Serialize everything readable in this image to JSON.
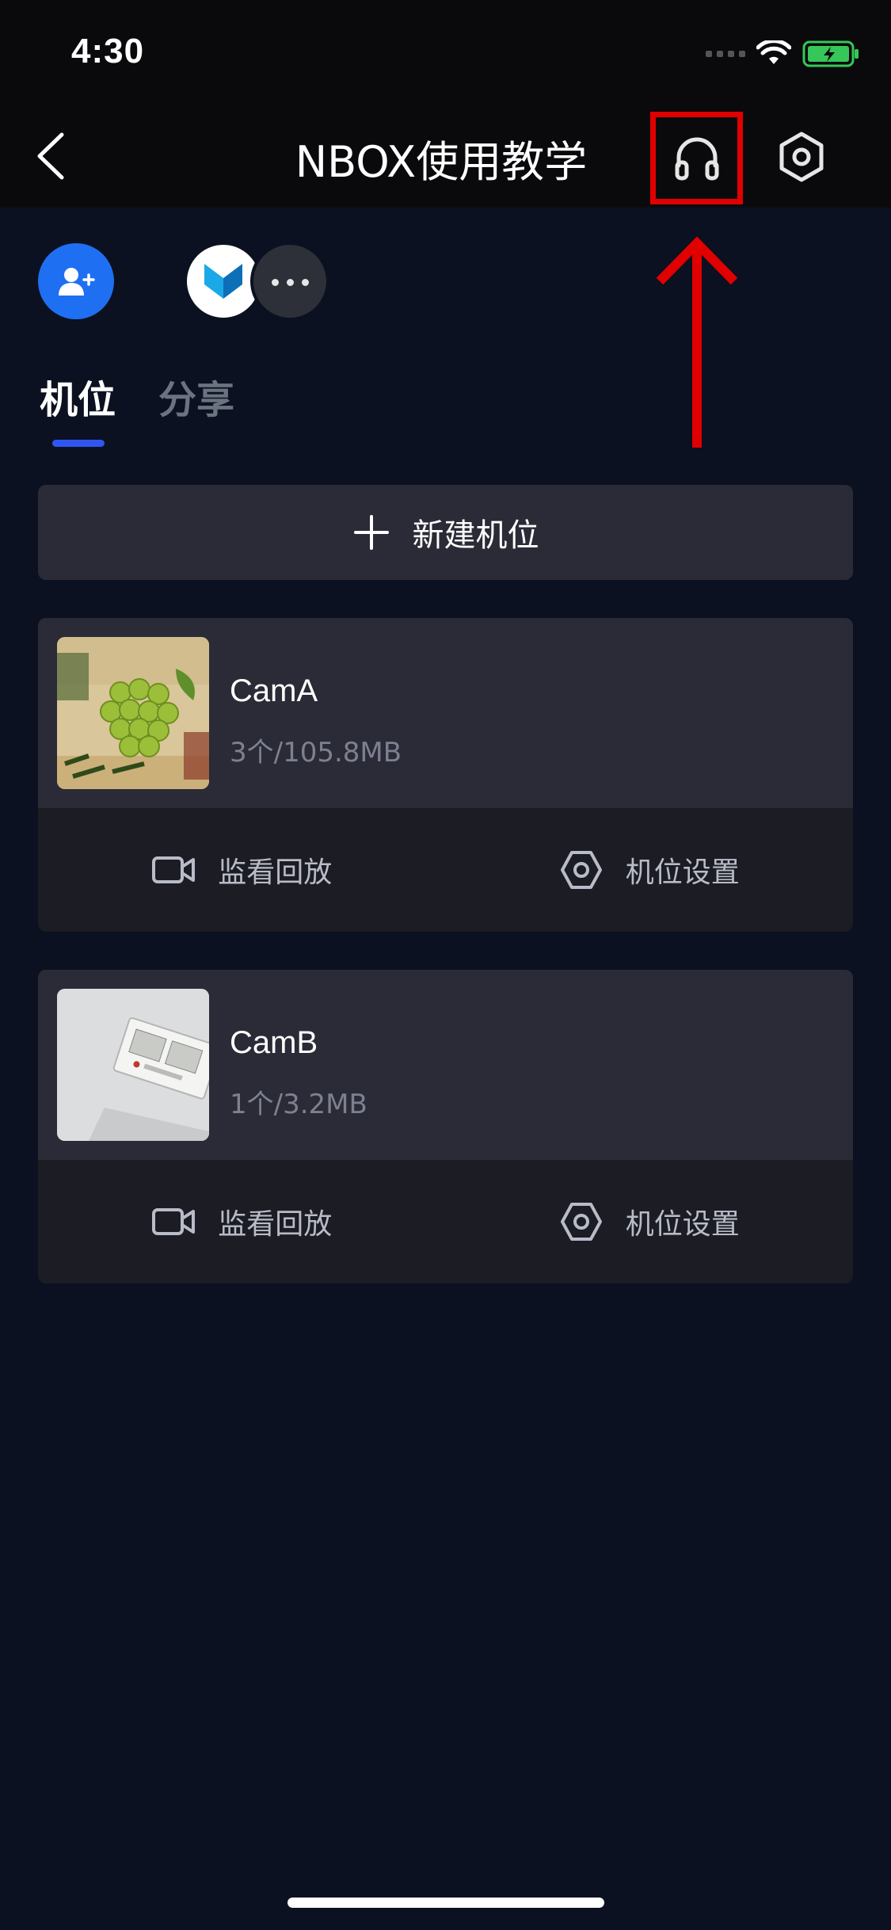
{
  "status_bar": {
    "time": "4:30"
  },
  "nav": {
    "title": "NBOX使用教学"
  },
  "tabs": [
    {
      "label": "机位"
    },
    {
      "label": "分享"
    }
  ],
  "new_position_button": {
    "label": "新建机位"
  },
  "cameras": [
    {
      "name": "CamA",
      "meta": "3个/105.8MB",
      "actions": {
        "playback": "监看回放",
        "settings": "机位设置"
      }
    },
    {
      "name": "CamB",
      "meta": "1个/3.2MB",
      "actions": {
        "playback": "监看回放",
        "settings": "机位设置"
      }
    }
  ],
  "icons": [
    "back-icon",
    "headset-icon",
    "settings-icon",
    "add-member-icon",
    "more-icon",
    "plus-icon",
    "video-camera-icon",
    "settings-hex-icon"
  ],
  "colors": {
    "accent": "#1f6ff2",
    "tab_indicator": "#3056f2",
    "annotation": "#e00000",
    "battery": "#35c759"
  }
}
